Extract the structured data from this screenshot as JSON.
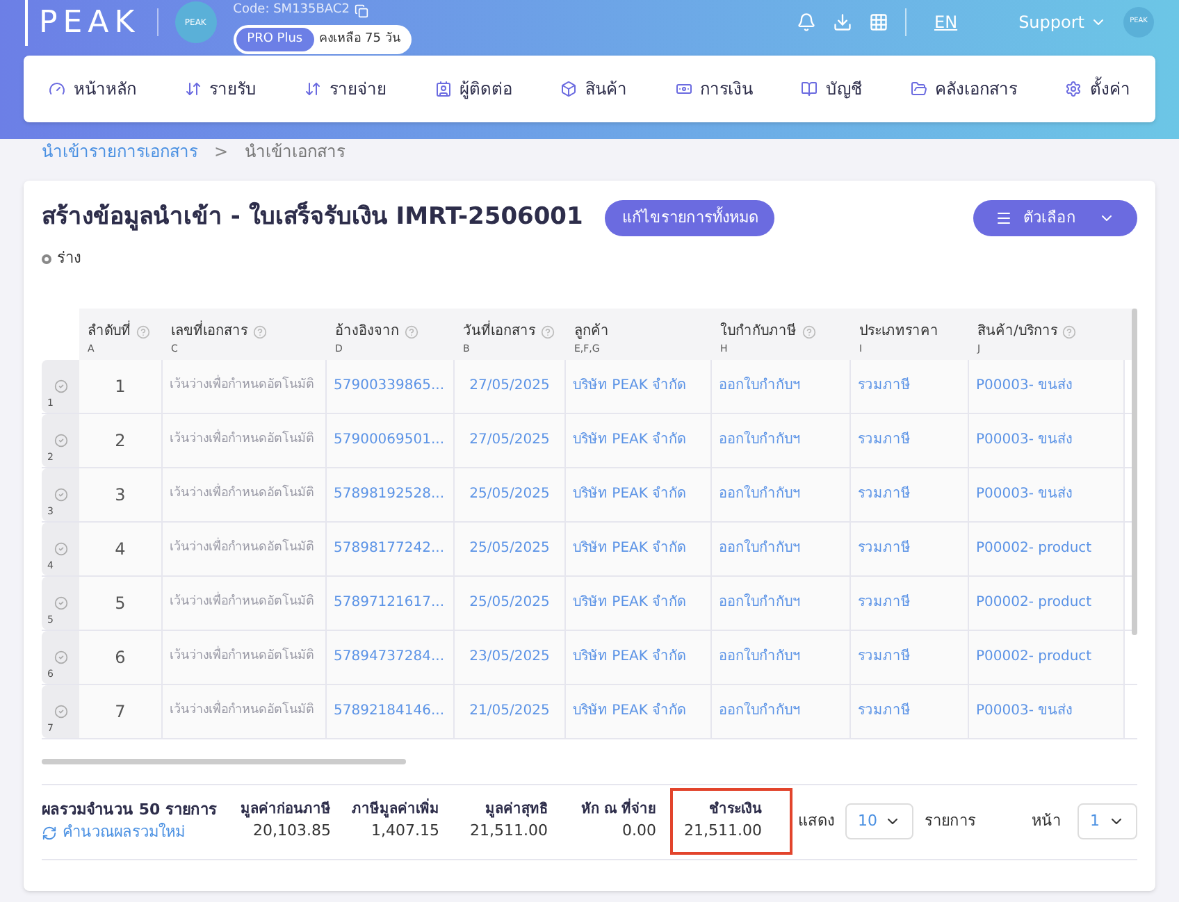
{
  "header": {
    "logo": "PEAK",
    "company_code": "Code: SM135BAC2",
    "plan_badge": "PRO Plus",
    "plan_remaining": "คงเหลือ 75 วัน",
    "language": "EN",
    "support": "Support",
    "company_avatar": "PEAK",
    "user_avatar": "PEAK"
  },
  "nav": [
    {
      "kind": "home",
      "label": "หน้าหลัก"
    },
    {
      "kind": "income",
      "label": "รายรับ"
    },
    {
      "kind": "expense",
      "label": "รายจ่าย"
    },
    {
      "kind": "contacts",
      "label": "ผู้ติดต่อ"
    },
    {
      "kind": "products",
      "label": "สินค้า"
    },
    {
      "kind": "finance",
      "label": "การเงิน"
    },
    {
      "kind": "accounts",
      "label": "บัญชี"
    },
    {
      "kind": "documents",
      "label": "คลังเอกสาร"
    },
    {
      "kind": "settings",
      "label": "ตั้งค่า"
    }
  ],
  "breadcrumb": [
    {
      "kind": "link",
      "label": "นำเข้ารายการเอกสาร"
    },
    {
      "kind": "separator",
      "label": ">"
    },
    {
      "kind": "current",
      "label": "นำเข้าเอกสาร"
    }
  ],
  "page": {
    "title": "สร้างข้อมูลนำเข้า - ใบเสร็จรับเงิน IMRT-2506001",
    "edit_all_button": "แก้ไขรายการทั้งหมด",
    "options_button": "ตัวเลือก",
    "status": "ร่าง"
  },
  "table": {
    "columns": [
      {
        "label": "ลำดับที่",
        "letter": "A",
        "help": true
      },
      {
        "label": "เลขที่เอกสาร",
        "letter": "C",
        "help": true
      },
      {
        "label": "อ้างอิงจาก",
        "letter": "D",
        "help": true
      },
      {
        "label": "วันที่เอกสาร",
        "letter": "B",
        "help": true
      },
      {
        "label": "ลูกค้า",
        "letter": "E,F,G",
        "help": false
      },
      {
        "label": "ใบกำกับภาษี",
        "letter": "H",
        "help": true
      },
      {
        "label": "ประเภทราคา",
        "letter": "I",
        "help": false
      },
      {
        "label": "สินค้า/บริการ",
        "letter": "J",
        "help": true
      }
    ],
    "rows": [
      {
        "row_number": "1",
        "cells": [
          "1",
          "เว้นว่างเพื่อกำหนดอัตโนมัติ",
          "57900339865...",
          "27/05/2025",
          "บริษัท PEAK จำกัด",
          "ออกใบกำกับฯ",
          "รวมภาษี",
          "P00003- ขนส่ง"
        ]
      },
      {
        "row_number": "2",
        "cells": [
          "2",
          "เว้นว่างเพื่อกำหนดอัตโนมัติ",
          "57900069501...",
          "27/05/2025",
          "บริษัท PEAK จำกัด",
          "ออกใบกำกับฯ",
          "รวมภาษี",
          "P00003- ขนส่ง"
        ]
      },
      {
        "row_number": "3",
        "cells": [
          "3",
          "เว้นว่างเพื่อกำหนดอัตโนมัติ",
          "57898192528...",
          "25/05/2025",
          "บริษัท PEAK จำกัด",
          "ออกใบกำกับฯ",
          "รวมภาษี",
          "P00003- ขนส่ง"
        ]
      },
      {
        "row_number": "4",
        "cells": [
          "4",
          "เว้นว่างเพื่อกำหนดอัตโนมัติ",
          "57898177242...",
          "25/05/2025",
          "บริษัท PEAK จำกัด",
          "ออกใบกำกับฯ",
          "รวมภาษี",
          "P00002- product"
        ]
      },
      {
        "row_number": "5",
        "cells": [
          "5",
          "เว้นว่างเพื่อกำหนดอัตโนมัติ",
          "57897121617...",
          "25/05/2025",
          "บริษัท PEAK จำกัด",
          "ออกใบกำกับฯ",
          "รวมภาษี",
          "P00002- product"
        ]
      },
      {
        "row_number": "6",
        "cells": [
          "6",
          "เว้นว่างเพื่อกำหนดอัตโนมัติ",
          "57894737284...",
          "23/05/2025",
          "บริษัท PEAK จำกัด",
          "ออกใบกำกับฯ",
          "รวมภาษี",
          "P00002- product"
        ]
      },
      {
        "row_number": "7",
        "cells": [
          "7",
          "เว้นว่างเพื่อกำหนดอัตโนมัติ",
          "57892184146...",
          "21/05/2025",
          "บริษัท PEAK จำกัด",
          "ออกใบกำกับฯ",
          "รวมภาษี",
          "P00003- ขนส่ง"
        ]
      }
    ]
  },
  "footer": {
    "total_label": "ผลรวมจำนวน 50 รายการ",
    "recalc_link": "คำนวณผลรวมใหม่",
    "totals": [
      {
        "label": "มูลค่าก่อนภาษี",
        "value": "20,103.85",
        "highlighted": false
      },
      {
        "label": "ภาษีมูลค่าเพิ่ม",
        "value": "1,407.15",
        "highlighted": false
      },
      {
        "label": "มูลค่าสุทธิ",
        "value": "21,511.00",
        "highlighted": false
      },
      {
        "label": "หัก ณ ที่จ่าย",
        "value": "0.00",
        "highlighted": false
      },
      {
        "label": "ชำระเงิน",
        "value": "21,511.00",
        "highlighted": true
      }
    ],
    "show_label": "แสดง",
    "page_size": "10",
    "items_label": "รายการ",
    "page_label": "หน้า",
    "page": "1"
  }
}
